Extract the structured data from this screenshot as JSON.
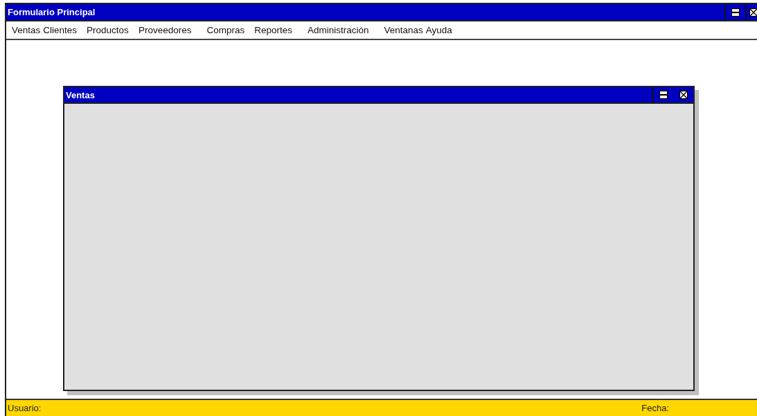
{
  "window": {
    "title": "Formulario Principal"
  },
  "menu": [
    {
      "label": "Ventas"
    },
    {
      "label": "Clientes"
    },
    {
      "label": "Productos"
    },
    {
      "label": "Proveedores"
    },
    {
      "label": "Compras"
    },
    {
      "label": "Reportes"
    },
    {
      "label": "Administración"
    },
    {
      "label": "Ventanas"
    },
    {
      "label": "Ayuda"
    }
  ],
  "child_window": {
    "title": "Ventas"
  },
  "status_bar": {
    "user_label": "Usuario:",
    "date_label": "Fecha:"
  }
}
